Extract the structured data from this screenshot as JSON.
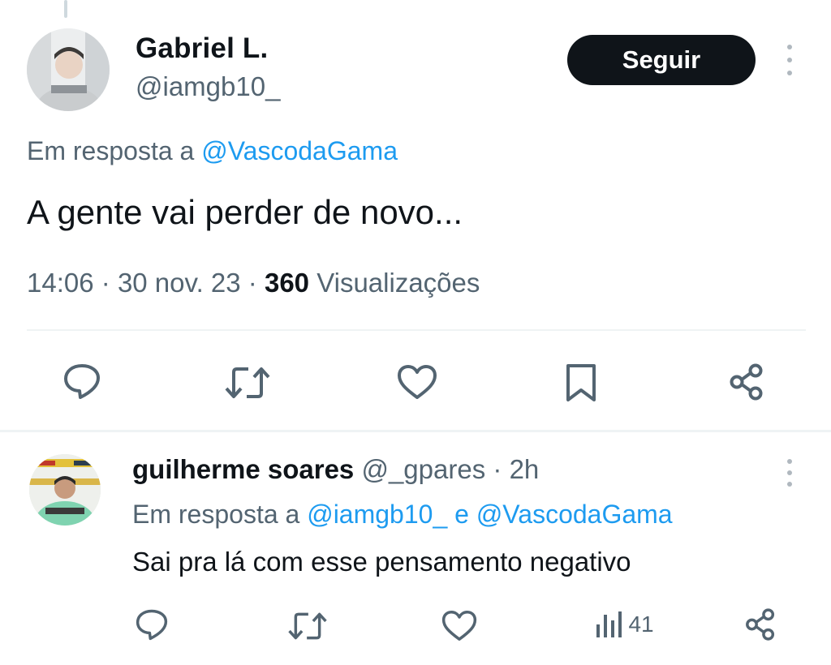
{
  "tweet": {
    "author_name": "Gabriel L.",
    "author_handle": "@iamgb10_",
    "follow_label": "Seguir",
    "reply_prefix": "Em resposta a",
    "reply_to": "@VascodaGama",
    "text": "A gente vai perder de novo...",
    "time": "14:06",
    "date": "30 nov. 23",
    "views_count": "360",
    "views_label": "Visualizações",
    "actions": [
      "reply-icon",
      "retweet-icon",
      "like-icon",
      "bookmark-icon",
      "share-icon"
    ]
  },
  "reply": {
    "author_name": "guilherme soares",
    "author_handle": "@_gpares",
    "age": "2h",
    "reply_prefix": "Em resposta a",
    "reply_to_1": "@iamgb10_",
    "conjunction": "e",
    "reply_to_2": "@VascodaGama",
    "text": "Sai pra lá com esse pensamento negativo",
    "views": "41",
    "actions": [
      "reply-icon",
      "retweet-icon",
      "like-icon",
      "views-icon",
      "share-icon"
    ]
  },
  "colors": {
    "link": "#1d9bf0",
    "muted": "#536471",
    "text": "#0f1419",
    "button_bg": "#0f1419",
    "divider": "#eff3f4"
  }
}
